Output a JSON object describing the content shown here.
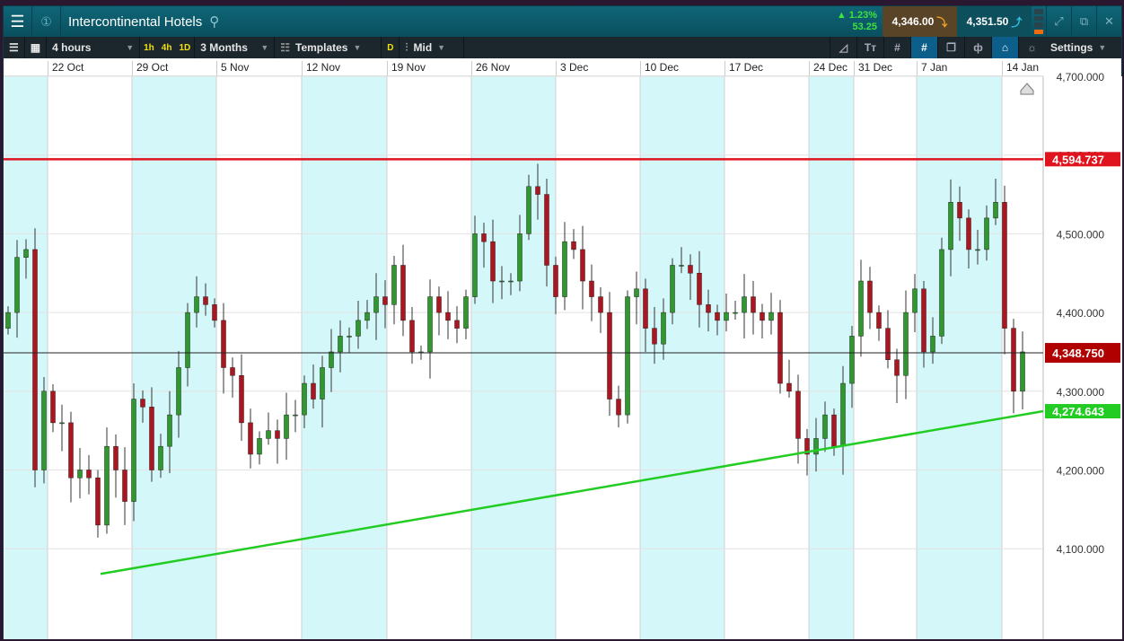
{
  "title": "Intercontinental Hotels",
  "quote": {
    "change_pct": "▲ 1.23%",
    "change_abs": "53.25",
    "sell": "4,346.00",
    "buy": "4,351.50"
  },
  "toolbar": {
    "interval": "4 hours",
    "q1": "1h",
    "q2": "4h",
    "q3": "1D",
    "range": "3 Months",
    "templates": "Templates",
    "d": "D",
    "price_type": "Mid",
    "settings": "Settings"
  },
  "chart_data": {
    "type": "candlestick",
    "title": "Intercontinental Hotels",
    "date_ticks": [
      "22 Oct",
      "29 Oct",
      "5 Nov",
      "12 Nov",
      "19 Nov",
      "26 Nov",
      "3 Dec",
      "10 Dec",
      "17 Dec",
      "24 Dec",
      "31 Dec",
      "7 Jan",
      "14 Jan"
    ],
    "price_ticks": [
      "4,700.000",
      "4,600.000",
      "4,500.000",
      "4,400.000",
      "4,300.000",
      "4,200.000",
      "4,100.000"
    ],
    "ylim": [
      4030,
      4715
    ],
    "closes": [
      4400,
      4470,
      4480,
      4200,
      4300,
      4260,
      4260,
      4190,
      4200,
      4190,
      4130,
      4230,
      4200,
      4160,
      4290,
      4280,
      4200,
      4230,
      4270,
      4330,
      4400,
      4420,
      4410,
      4390,
      4330,
      4320,
      4260,
      4220,
      4240,
      4250,
      4240,
      4270,
      4270,
      4310,
      4290,
      4330,
      4350,
      4370,
      4370,
      4390,
      4400,
      4420,
      4410,
      4460,
      4390,
      4350,
      4350,
      4420,
      4400,
      4390,
      4380,
      4420,
      4500,
      4490,
      4440,
      4440,
      4440,
      4500,
      4560,
      4550,
      4460,
      4420,
      4490,
      4480,
      4440,
      4420,
      4400,
      4290,
      4270,
      4420,
      4430,
      4380,
      4360,
      4400,
      4460,
      4460,
      4450,
      4410,
      4400,
      4390,
      4400,
      4400,
      4420,
      4400,
      4390,
      4400,
      4310,
      4300,
      4240,
      4220,
      4240,
      4270,
      4230,
      4310,
      4370,
      4440,
      4400,
      4380,
      4340,
      4320,
      4400,
      4430,
      4350,
      4370,
      4480,
      4540,
      4520,
      4480,
      4480,
      4520,
      4540,
      4380,
      4300,
      4350
    ],
    "resistance": {
      "label": "4,594.737",
      "value": 4594.737,
      "color": "#e0141e"
    },
    "current": {
      "label": "4,348.750",
      "value": 4348.75,
      "color": "#b00000"
    },
    "trendline": {
      "label": "4,274.643",
      "start_value": 4068,
      "end_value": 4274.643,
      "color": "#22cc22"
    },
    "up_color": "#2e9a2e",
    "down_color": "#b0141e"
  }
}
